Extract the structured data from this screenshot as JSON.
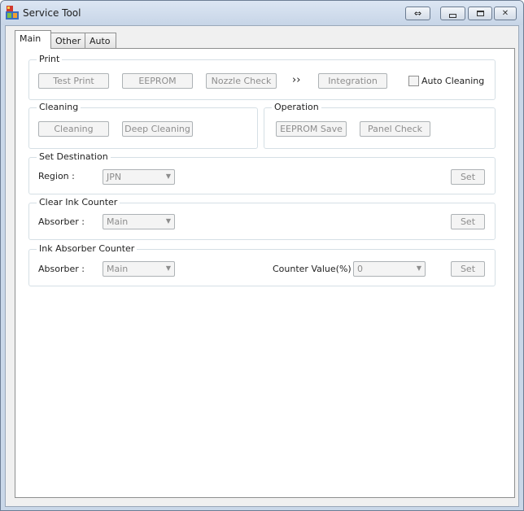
{
  "window": {
    "title": "Service Tool",
    "controls": {
      "swap_icon": "⇔",
      "minimize_icon": "▭",
      "maximize_icon": "▢",
      "close_icon": "✕"
    }
  },
  "tabs": [
    {
      "label": "Main",
      "active": true
    },
    {
      "label": "Other",
      "active": false
    },
    {
      "label": "Auto",
      "active": false
    }
  ],
  "print": {
    "title": "Print",
    "test_print": "Test Print",
    "eeprom": "EEPROM",
    "nozzle_check": "Nozzle Check",
    "arrow": "››",
    "integration": "Integration",
    "auto_cleaning": "Auto Cleaning"
  },
  "cleaning": {
    "title": "Cleaning",
    "cleaning": "Cleaning",
    "deep_cleaning": "Deep Cleaning"
  },
  "operation": {
    "title": "Operation",
    "eeprom_save": "EEPROM Save",
    "panel_check": "Panel Check"
  },
  "set_destination": {
    "title": "Set Destination",
    "region_label": "Region :",
    "region_value": "JPN",
    "set": "Set"
  },
  "clear_ink_counter": {
    "title": "Clear Ink Counter",
    "absorber_label": "Absorber :",
    "absorber_value": "Main",
    "set": "Set"
  },
  "ink_absorber_counter": {
    "title": "Ink Absorber Counter",
    "absorber_label": "Absorber :",
    "absorber_value": "Main",
    "counter_label": "Counter Value(%) :",
    "counter_value": "0",
    "set": "Set"
  },
  "colors": {
    "titlebar": "#c9d7e8",
    "panel": "#ffffff",
    "disabled_text": "#8d8d8d"
  }
}
